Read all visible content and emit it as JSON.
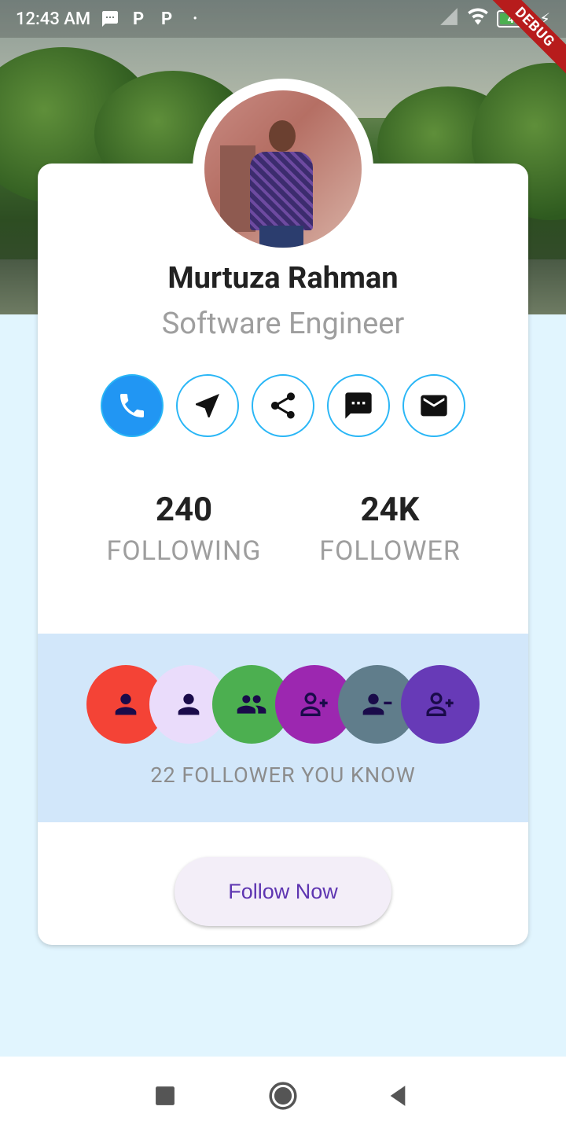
{
  "status_bar": {
    "time": "12:43 AM",
    "battery": "43",
    "debug_label": "DEBUG"
  },
  "profile": {
    "name": "Murtuza Rahman",
    "role": "Software Engineer",
    "avatar_alt": "profile photo"
  },
  "actions": [
    {
      "name": "call",
      "icon": "phone-icon"
    },
    {
      "name": "navigate",
      "icon": "navigation-arrow-icon"
    },
    {
      "name": "share",
      "icon": "share-icon"
    },
    {
      "name": "message",
      "icon": "message-icon"
    },
    {
      "name": "email",
      "icon": "mail-icon"
    }
  ],
  "stats": {
    "following_count": "240",
    "following_label": "FOLLOWING",
    "follower_count": "24K",
    "follower_label": "FOLLOWER"
  },
  "followers_you_know": {
    "text": "22 FOLLOWER YOU KNOW",
    "circles": [
      {
        "color": "#f44336",
        "icon": "person-icon"
      },
      {
        "color": "#eadcfb",
        "icon": "person-icon"
      },
      {
        "color": "#4caf50",
        "icon": "people-icon"
      },
      {
        "color": "#9c27b0",
        "icon": "person-add-icon"
      },
      {
        "color": "#607d8b",
        "icon": "person-remove-icon"
      },
      {
        "color": "#673ab7",
        "icon": "person-add-icon"
      }
    ]
  },
  "follow_button": {
    "label": "Follow Now"
  },
  "colors": {
    "accent": "#2196f3",
    "button_text": "#5e35b1"
  }
}
